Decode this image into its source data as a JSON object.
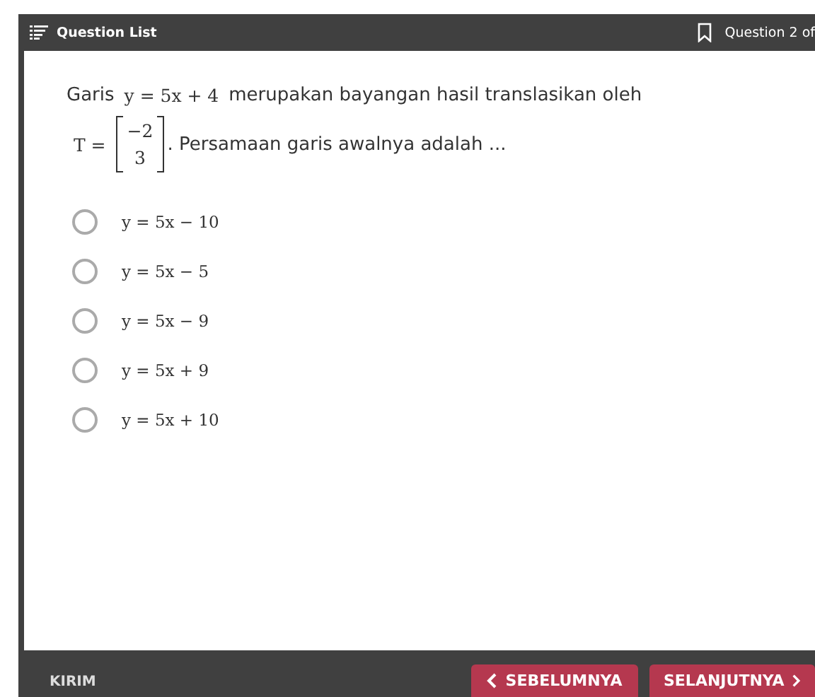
{
  "header": {
    "menu_label": "Question List",
    "progress": "Question 2 of"
  },
  "question": {
    "lines": [
      [
        {
          "kind": "text",
          "text": "Garis"
        },
        {
          "kind": "math",
          "text": "y = 5x + 4"
        },
        {
          "kind": "text",
          "text": "merupakan bayangan hasil translasikan oleh"
        }
      ],
      [
        {
          "kind": "math",
          "text": "T ="
        },
        {
          "kind": "matrix",
          "entries": [
            "−2",
            "3"
          ]
        },
        {
          "kind": "text",
          "text": ". Persamaan garis awalnya adalah  ..."
        }
      ]
    ]
  },
  "options": [
    {
      "text": "y = 5x − 10",
      "selected": false
    },
    {
      "text": "y = 5x − 5",
      "selected": false
    },
    {
      "text": "y = 5x − 9",
      "selected": false
    },
    {
      "text": "y = 5x + 9",
      "selected": false
    },
    {
      "text": "y = 5x + 10",
      "selected": false
    }
  ],
  "footer": {
    "submit": "KIRIM",
    "previous": "SEBELUMNYA",
    "next": "SELANJUTNYA"
  }
}
